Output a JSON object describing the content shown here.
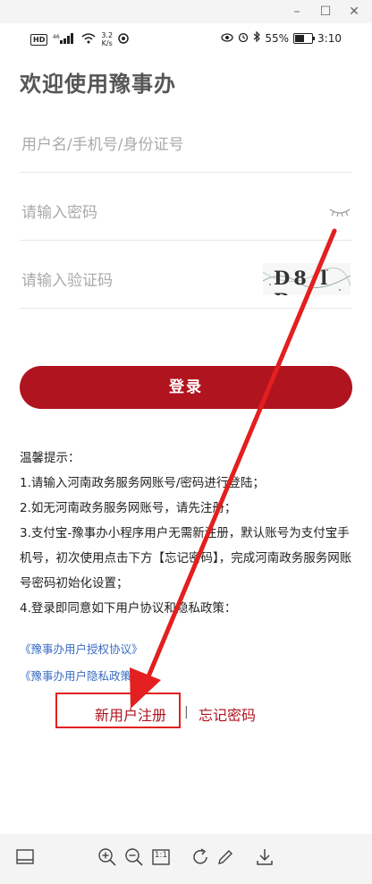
{
  "status_bar": {
    "hd": "HD",
    "signal": "⁴⁶",
    "speed_value": "3.2",
    "speed_unit": "K/s",
    "battery": "55%",
    "time": "3:10"
  },
  "login": {
    "title": "欢迎使用豫事办",
    "username_placeholder": "用户名/手机号/身份证号",
    "password_placeholder": "请输入密码",
    "captcha_placeholder": "请输入验证码",
    "captcha_text": "D8 l B",
    "login_button": "登录"
  },
  "tips": {
    "heading": "温馨提示：",
    "lines": [
      "1.请输入河南政务服务网账号/密码进行登陆；",
      "2.如无河南政务服务网账号，请先注册；",
      "3.支付宝-豫事办小程序用户无需新注册，默认账号为支付宝手机号，初次使用点击下方【忘记密码】，完成河南政务服务网账号密码初始化设置；",
      "4.登录即同意如下用户协议和隐私政策："
    ]
  },
  "links": {
    "agreement": "《豫事办用户授权协议》",
    "privacy": "《豫事办用户隐私政策》"
  },
  "actions": {
    "register": "新用户注册",
    "separator": "|",
    "forgot": "忘记密码"
  },
  "toolbar_icons": [
    "panel-icon",
    "zoom-in-icon",
    "zoom-out-icon",
    "actual-size-icon",
    "rotate-icon",
    "pen-icon",
    "download-icon"
  ],
  "toolbar": {
    "actual_size_label": "1:1"
  },
  "colors": {
    "brand_red": "#b0141e",
    "link_blue": "#3a6cc2",
    "annotation_red": "#e31f1f"
  }
}
